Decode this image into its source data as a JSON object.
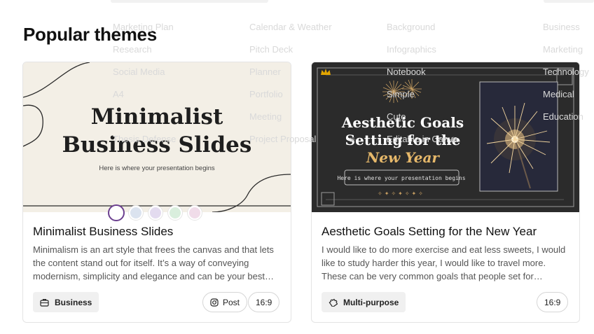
{
  "section": {
    "title": "Popular themes"
  },
  "ghost_menu": {
    "col1": [
      "Marketing Plan",
      "Research",
      "Social Media",
      "A4",
      "Thesis Defense"
    ],
    "col2": [
      "Calendar & Weather",
      "Pitch Deck",
      "Planner",
      "Portfolio",
      "Meeting",
      "Project Proposal"
    ],
    "col3": [
      "Background",
      "Infographics",
      "Notebook",
      "Simple",
      "Cute",
      "Editable in Canva"
    ],
    "col4": [
      "Business",
      "Marketing",
      "Technology",
      "Medical",
      "Education"
    ]
  },
  "cards": [
    {
      "slide": {
        "title_line1": "Minimalist",
        "title_line2": "Business Slides",
        "subtitle": "Here is where your presentation begins"
      },
      "swatch_colors": [
        "#ffffff",
        "#dbe3ef",
        "#e3dbef",
        "#d9eedd",
        "#f0dce9"
      ],
      "title": "Minimalist Business Slides",
      "description": "Minimalism is an art style that frees the canvas and that lets the content stand out for itself. It’s a way of conveying modernism, simplicity and elegance and can be your best…",
      "category": "Business",
      "format": "Post",
      "ratio": "16:9"
    },
    {
      "slide": {
        "title_line1": "Aesthetic Goals",
        "title_line2": "Setting for the",
        "title_line3": "New Year",
        "subtitle": "Here is where your presentation begins"
      },
      "title": "Aesthetic Goals Setting for the New Year",
      "description": "I would like to do more exercise and eat less sweets, I would like to study harder this year, I would like to travel more. These can be very common goals that people set for…",
      "category": "Multi-purpose",
      "ratio": "16:9"
    }
  ],
  "colors": {
    "accent": "#6b3f8f",
    "gold": "#e6b86a",
    "cream": "#f3efe6"
  }
}
